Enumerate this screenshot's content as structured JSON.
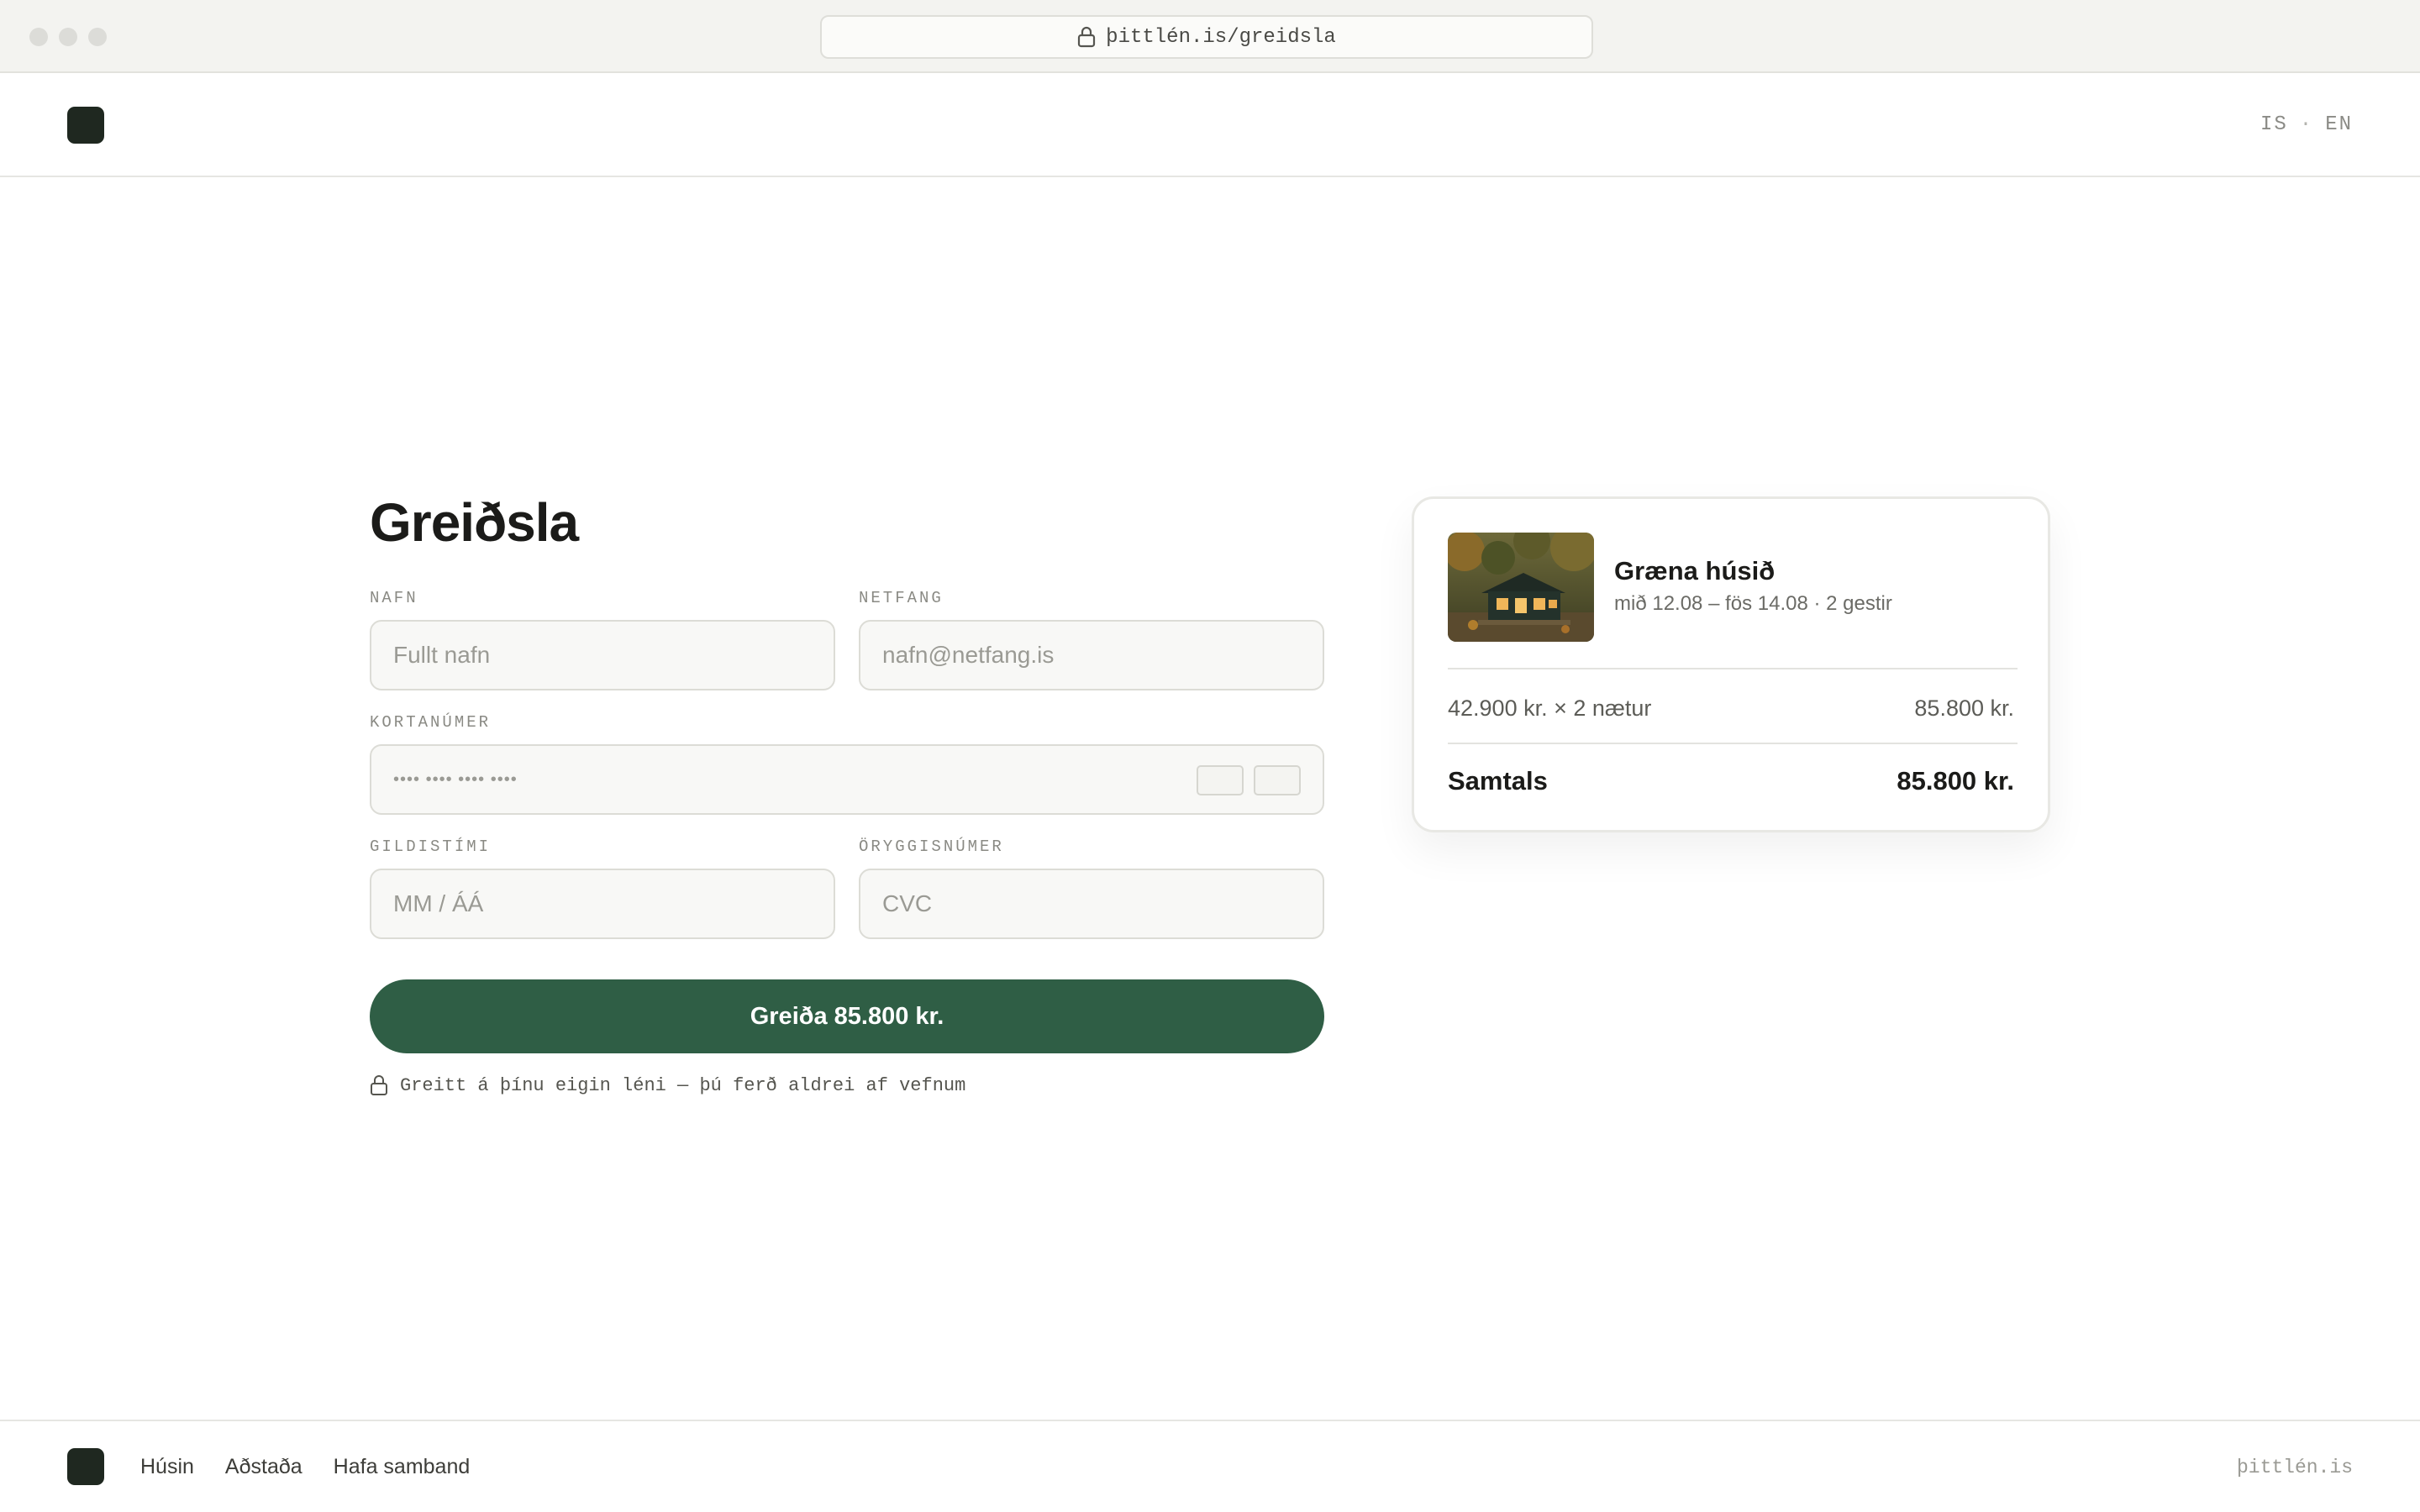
{
  "browser": {
    "url": "þittlén.is/greidsla",
    "lock_icon": "lock-icon"
  },
  "header": {
    "lang_is": "IS",
    "lang_sep": "·",
    "lang_en": "EN"
  },
  "form": {
    "title": "Greiðsla",
    "name": {
      "label": "NAFN",
      "placeholder": "Fullt nafn"
    },
    "email": {
      "label": "NETFANG",
      "placeholder": "nafn@netfang.is"
    },
    "card": {
      "label": "KORTANÚMER",
      "placeholder": "•••• •••• •••• ••••"
    },
    "expiry": {
      "label": "GILDISTÍMI",
      "placeholder": "MM / ÁÁ"
    },
    "cvc": {
      "label": "ÖRYGGISNÚMER",
      "placeholder": "CVC"
    },
    "pay_button": "Greiða 85.800 kr.",
    "secure_note": "Greitt á þínu eigin léni — þú ferð aldrei af vefnum"
  },
  "summary": {
    "house_name": "Græna húsið",
    "dates": "mið 12.08 – fös 14.08 · 2 gestir",
    "line_desc": "42.900 kr. × 2 nætur",
    "line_amount": "85.800 kr.",
    "total_label": "Samtals",
    "total_amount": "85.800 kr."
  },
  "footer": {
    "nav": [
      "Húsin",
      "Aðstaða",
      "Hafa samband"
    ],
    "domain": "þittlén.is"
  },
  "colors": {
    "accent": "#2f5e45",
    "logo": "#1f2820"
  }
}
